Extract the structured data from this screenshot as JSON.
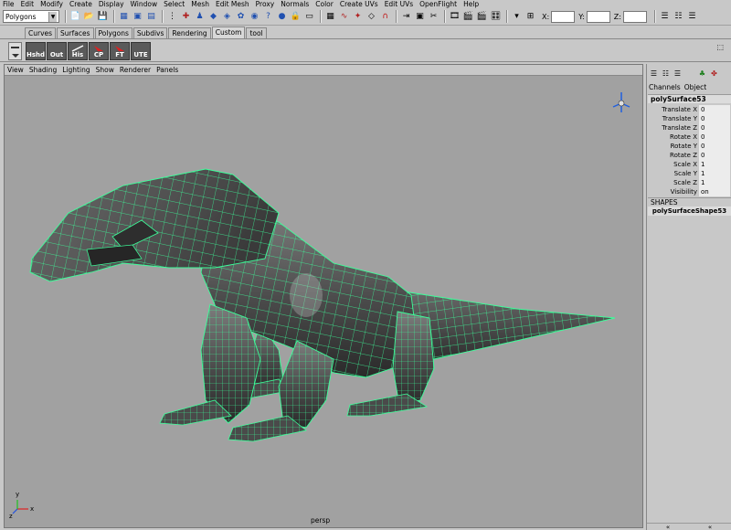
{
  "menu": [
    "File",
    "Edit",
    "Modify",
    "Create",
    "Display",
    "Window",
    "Select",
    "Mesh",
    "Edit Mesh",
    "Proxy",
    "Normals",
    "Color",
    "Create UVs",
    "Edit UVs",
    "OpenFlight",
    "Help"
  ],
  "status": {
    "mode": "Polygons",
    "x_label": "X:",
    "y_label": "Y:",
    "z_label": "Z:"
  },
  "shelf": {
    "tabs": [
      "Curves",
      "Surfaces",
      "Polygons",
      "Subdivs",
      "Rendering",
      "Custom",
      "tool"
    ],
    "active_tab": "Custom",
    "buttons": [
      "Hshd",
      "Out",
      "His",
      "CP",
      "FT",
      "UTE"
    ]
  },
  "viewport": {
    "menu": [
      "View",
      "Shading",
      "Lighting",
      "Show",
      "Renderer",
      "Panels"
    ],
    "camera_label": "persp",
    "axis_x": "x",
    "axis_y": "y",
    "axis_z": "z",
    "wireframe_color": "#3cff9a"
  },
  "channel_box": {
    "tabs": [
      "Channels",
      "Object"
    ],
    "object_name": "polySurface53",
    "attributes": [
      {
        "name": "Translate X",
        "value": "0"
      },
      {
        "name": "Translate Y",
        "value": "0"
      },
      {
        "name": "Translate Z",
        "value": "0"
      },
      {
        "name": "Rotate X",
        "value": "0"
      },
      {
        "name": "Rotate Y",
        "value": "0"
      },
      {
        "name": "Rotate Z",
        "value": "0"
      },
      {
        "name": "Scale X",
        "value": "1"
      },
      {
        "name": "Scale Y",
        "value": "1"
      },
      {
        "name": "Scale Z",
        "value": "1"
      },
      {
        "name": "Visibility",
        "value": "on"
      }
    ],
    "shapes_header": "SHAPES",
    "shape_name": "polySurfaceShape53",
    "scroll_left": "«",
    "scroll_right": "«"
  }
}
